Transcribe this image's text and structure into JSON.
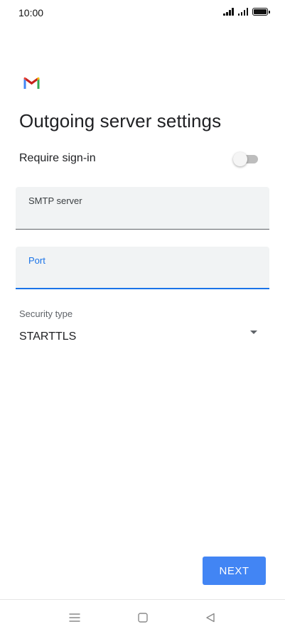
{
  "status_bar": {
    "time": "10:00",
    "icons": [
      "signal-icon",
      "signal-icon",
      "battery-icon"
    ]
  },
  "app": {
    "logo": "gmail-logo-icon",
    "brand_colors": {
      "blue": "#4285f4",
      "red": "#ea4335",
      "yellow": "#fbbc04",
      "green": "#34a853"
    }
  },
  "page": {
    "title": "Outgoing server settings"
  },
  "require_signin": {
    "label": "Require sign-in",
    "enabled": false
  },
  "fields": {
    "smtp_server": {
      "label": "SMTP server",
      "value": ""
    },
    "port": {
      "label": "Port",
      "value": "",
      "focused": true
    }
  },
  "security": {
    "label": "Security type",
    "value": "STARTTLS"
  },
  "actions": {
    "next_label": "NEXT",
    "accent_color": "#4285f4"
  },
  "nav_bar": {
    "icons": [
      "menu-icon",
      "home-icon",
      "back-icon"
    ]
  }
}
